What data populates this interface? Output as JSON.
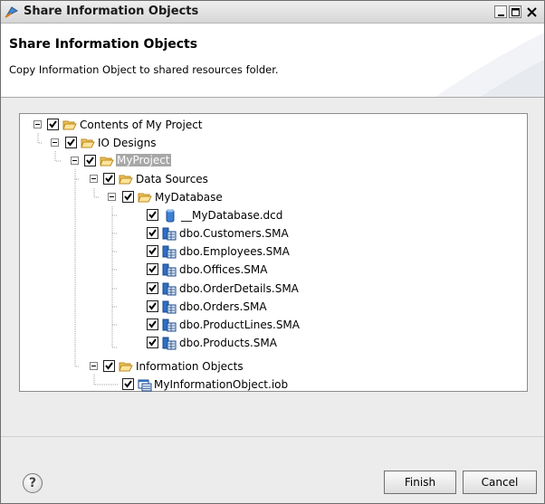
{
  "window": {
    "title": "Share Information Objects"
  },
  "header": {
    "title": "Share Information Objects",
    "description": "Copy Information Object to shared resources folder."
  },
  "tree": {
    "root": "Contents of My Project",
    "io_designs": "IO Designs",
    "project": "MyProject",
    "data_sources": "Data Sources",
    "database": "MyDatabase",
    "dcd_file": "__MyDatabase.dcd",
    "sma_files": [
      "dbo.Customers.SMA",
      "dbo.Employees.SMA",
      "dbo.Offices.SMA",
      "dbo.OrderDetails.SMA",
      "dbo.Orders.SMA",
      "dbo.ProductLines.SMA",
      "dbo.Products.SMA"
    ],
    "information_objects": "Information Objects",
    "iob_file": "MyInformationObject.iob"
  },
  "buttons": {
    "finish": "Finish",
    "cancel": "Cancel",
    "help": "?"
  },
  "icons": {
    "folder": "folder-open-icon",
    "database": "database-icon",
    "sma": "data-source-icon",
    "iob": "information-object-icon"
  }
}
